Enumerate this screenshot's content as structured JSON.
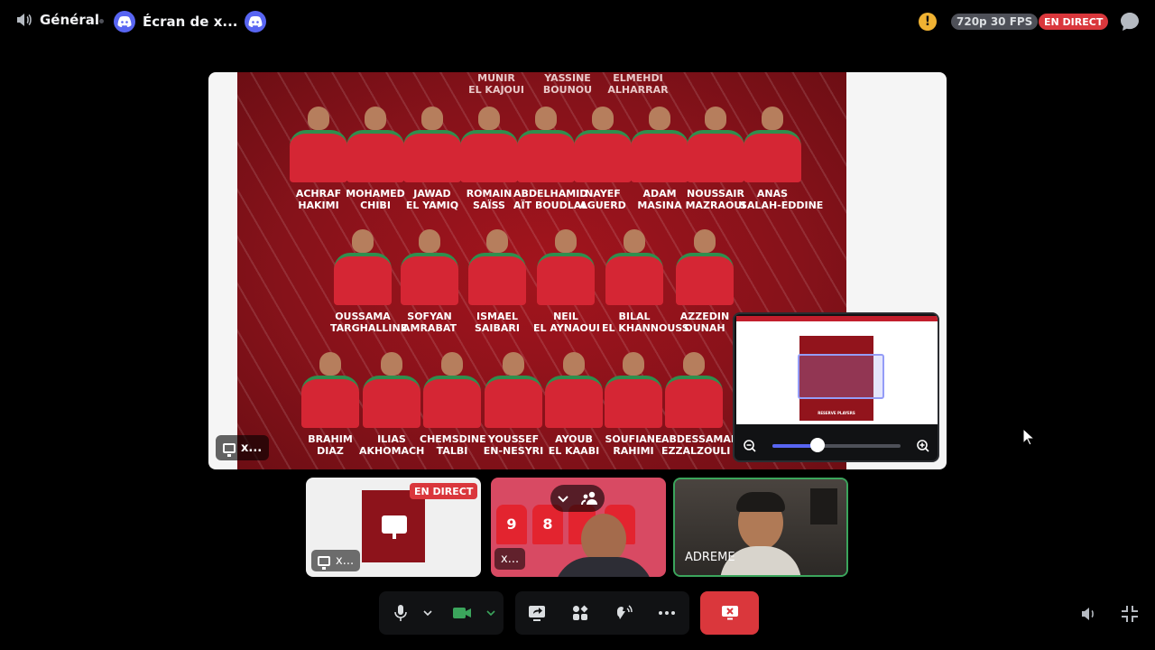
{
  "topbar": {
    "channel_name": "Général",
    "stream_title": "Écran de x...",
    "quality": "720p 30 FPS",
    "live_badge": "EN DIRECT",
    "icons": [
      "speaker-icon",
      "discord-logo-icon",
      "warning-icon",
      "chat-icon"
    ]
  },
  "stage": {
    "label": "x...",
    "top_names": [
      {
        "first": "MUNIR",
        "last": "EL KAJOUI"
      },
      {
        "first": "YASSINE",
        "last": "BOUNOU"
      },
      {
        "first": "ELMEHDI",
        "last": "ALHARRAR"
      }
    ],
    "row1": [
      {
        "first": "ACHRAF",
        "last": "HAKIMI"
      },
      {
        "first": "MOHAMED",
        "last": "CHIBI"
      },
      {
        "first": "JAWAD",
        "last": "EL YAMIQ"
      },
      {
        "first": "ROMAIN",
        "last": "SAÏSS"
      },
      {
        "first": "ABDELHAMID",
        "last": "AÏT BOUDLAL"
      },
      {
        "first": "NAYEF",
        "last": "AGUERD"
      },
      {
        "first": "ADAM",
        "last": "MASINA"
      },
      {
        "first": "NOUSSAIR",
        "last": "MAZRAOUI"
      },
      {
        "first": "ANAS",
        "last": "SALAH-EDDINE"
      }
    ],
    "row2": [
      {
        "first": "OUSSAMA",
        "last": "TARGHALLINE"
      },
      {
        "first": "SOFYAN",
        "last": "AMRABAT"
      },
      {
        "first": "ISMAEL",
        "last": "SAIBARI"
      },
      {
        "first": "NEIL",
        "last": "EL AYNAOUI"
      },
      {
        "first": "BILAL",
        "last": "EL KHANNOUSS"
      },
      {
        "first": "AZZEDIN",
        "last": "OUNAH"
      }
    ],
    "row3": [
      {
        "first": "BRAHIM",
        "last": "DIAZ"
      },
      {
        "first": "ILIAS",
        "last": "AKHOMACH"
      },
      {
        "first": "CHEMSDINE",
        "last": "TALBI"
      },
      {
        "first": "YOUSSEF",
        "last": "EN-NESYRI"
      },
      {
        "first": "AYOUB",
        "last": "EL KAABI"
      },
      {
        "first": "SOUFIANE",
        "last": "RAHIMI"
      },
      {
        "first": "ABDESSAMAD",
        "last": "EZZALZOULI"
      }
    ]
  },
  "zoom": {
    "level": 0.35,
    "preview_caption": "RESERVE PLAYERS"
  },
  "tiles": [
    {
      "label": "x...",
      "live": "EN DIRECT"
    },
    {
      "label": "x...",
      "jerseys": [
        "9",
        "8"
      ]
    },
    {
      "label": "ADREME"
    }
  ],
  "controls": {
    "buttons": [
      "microphone",
      "mic-options",
      "camera",
      "camera-options",
      "share-screen",
      "activities",
      "soundboard",
      "more",
      "disconnect"
    ]
  },
  "colors": {
    "accent": "#5865f2",
    "live": "#da373c",
    "speaking": "#3ba55c",
    "camera_on": "#3ba55c"
  }
}
